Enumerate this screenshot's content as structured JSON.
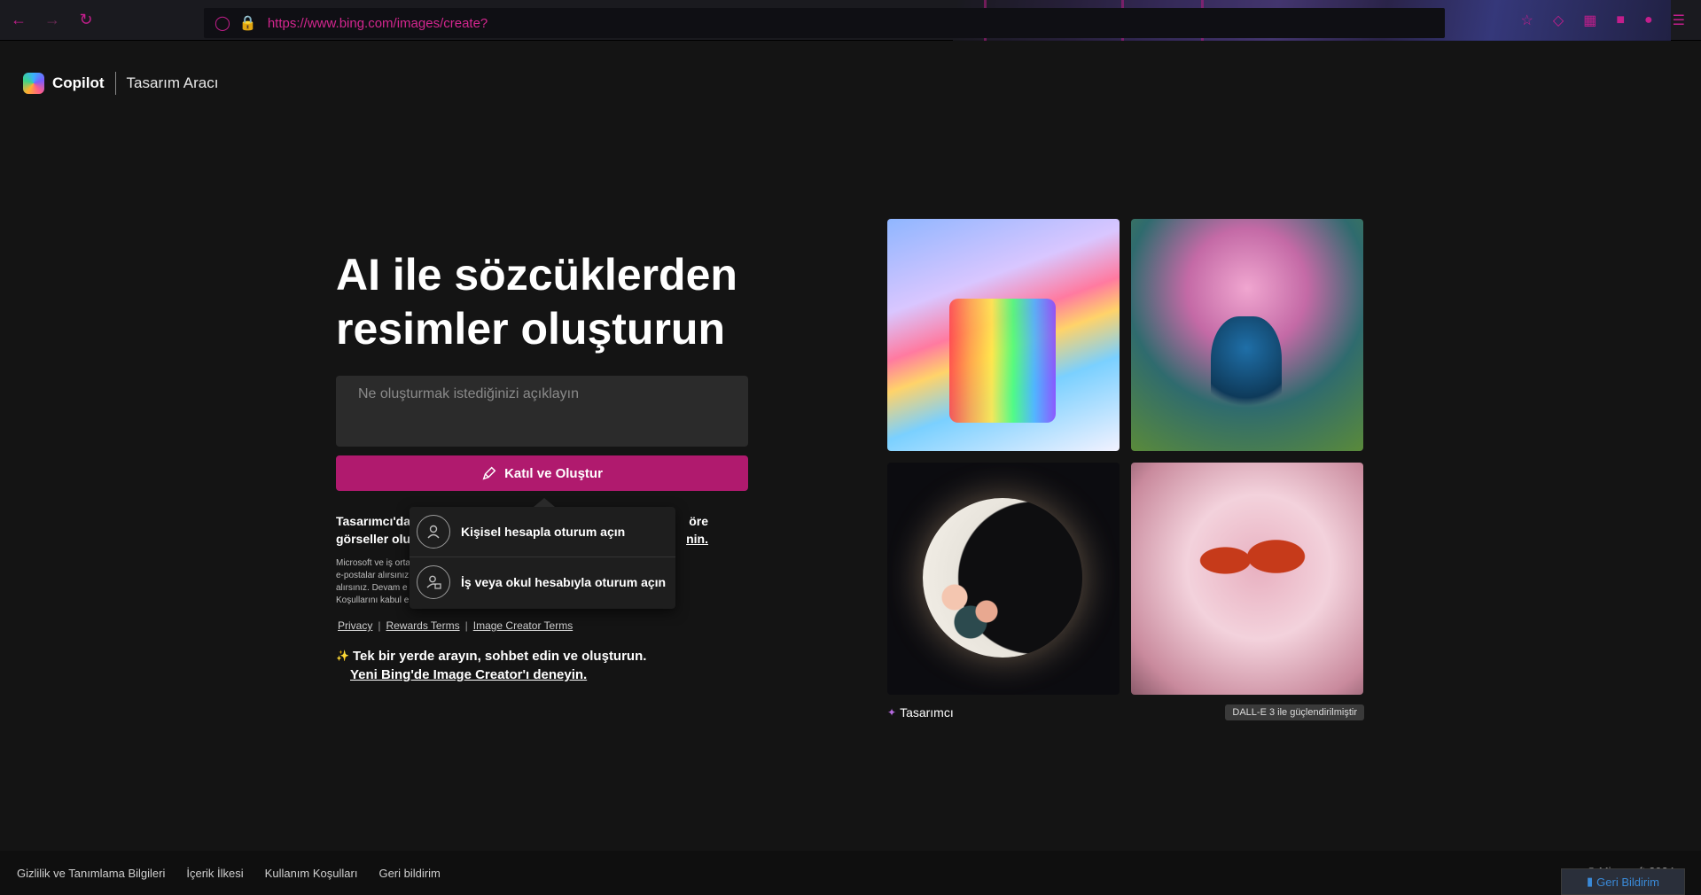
{
  "browser": {
    "url": "https://www.bing.com/images/create?",
    "back_icon": "arrow-left-icon",
    "forward_icon": "arrow-right-icon",
    "reload_icon": "reload-icon"
  },
  "header": {
    "brand": "Copilot",
    "product": "Tasarım Aracı"
  },
  "hero": {
    "title_line1": "AI ile sözcüklerden",
    "title_line2": "resimler oluşturun"
  },
  "prompt": {
    "placeholder": "Ne oluşturmak istediğinizi açıklayın"
  },
  "join_button": {
    "label": "Katıl ve Oluştur"
  },
  "info": {
    "bold_part1": "Tasarımcı'da",
    "bold_part1_tail": "öre",
    "bold_part2": "görseller olu",
    "bold_link_tail": "nin.",
    "small_lines": [
      "Microsoft ve iş orta",
      "e-postalar alırsınız",
      "alırsınız. Devam e",
      "Koşullarını kabul e"
    ]
  },
  "legal": {
    "privacy": "Privacy",
    "rewards": "Rewards Terms",
    "creator": "Image Creator Terms",
    "sep": "|"
  },
  "try_new": {
    "text": "Tek bir yerde arayın, sohbet edin ve oluşturun.",
    "link": "Yeni Bing'de Image Creator'ı deneyin."
  },
  "popup": {
    "personal": "Kişisel hesapla oturum açın",
    "work": "İş veya okul hesabıyla oturum açın"
  },
  "gallery": {
    "designer_label": "Tasarımcı",
    "badge": "DALL-E 3 ile güçlendirilmiştir"
  },
  "footer": {
    "links": [
      "Gizlilik ve Tanımlama Bilgileri",
      "İçerik İlkesi",
      "Kullanım Koşulları",
      "Geri bildirim"
    ],
    "copyright": "© Microsoft 2024",
    "feedback_button": "Geri Bildirim"
  },
  "colors": {
    "accent": "#b01a6e",
    "browser_accent": "#c31e8c"
  }
}
